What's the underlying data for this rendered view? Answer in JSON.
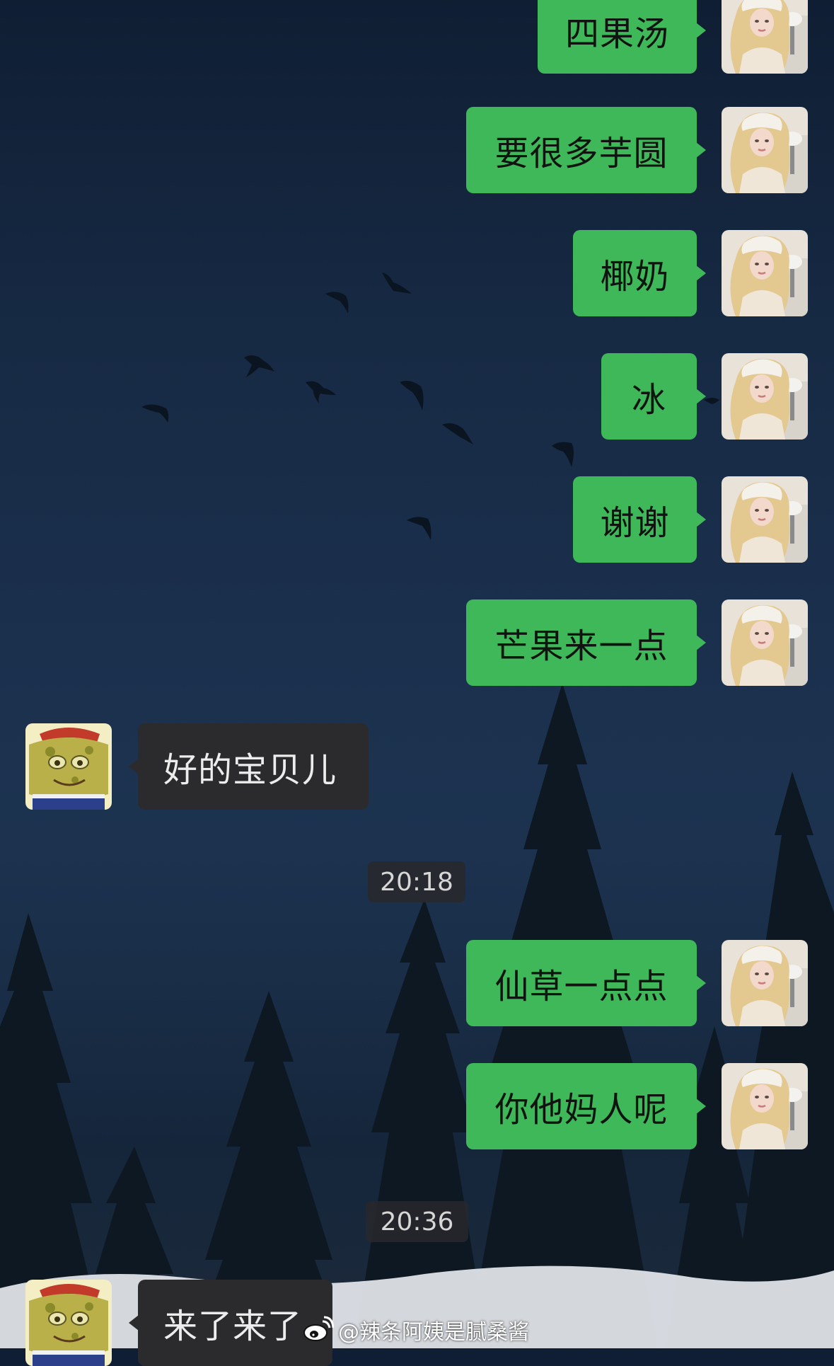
{
  "conversation": {
    "messages": [
      {
        "sender": "me",
        "text": "四果汤"
      },
      {
        "sender": "me",
        "text": "要很多芋圆"
      },
      {
        "sender": "me",
        "text": "椰奶"
      },
      {
        "sender": "me",
        "text": "冰"
      },
      {
        "sender": "me",
        "text": "谢谢"
      },
      {
        "sender": "me",
        "text": "芒果来一点"
      },
      {
        "sender": "other",
        "text": "好的宝贝儿"
      },
      {
        "sender": "me",
        "text": "仙草一点点"
      },
      {
        "sender": "me",
        "text": "你他妈人呢"
      },
      {
        "sender": "other",
        "text": "来了来了"
      }
    ],
    "timestamps": [
      "20:18",
      "20:36"
    ]
  },
  "avatars": {
    "me": "blonde-girl-avatar",
    "other": "spongebob-meme-avatar"
  },
  "watermark": {
    "icon": "weibo-icon",
    "text": "@辣条阿姨是腻桑酱"
  },
  "colors": {
    "outgoing_bubble": "#3fb85a",
    "incoming_bubble": "#2b2b2d",
    "background": "#1a2f4c"
  }
}
